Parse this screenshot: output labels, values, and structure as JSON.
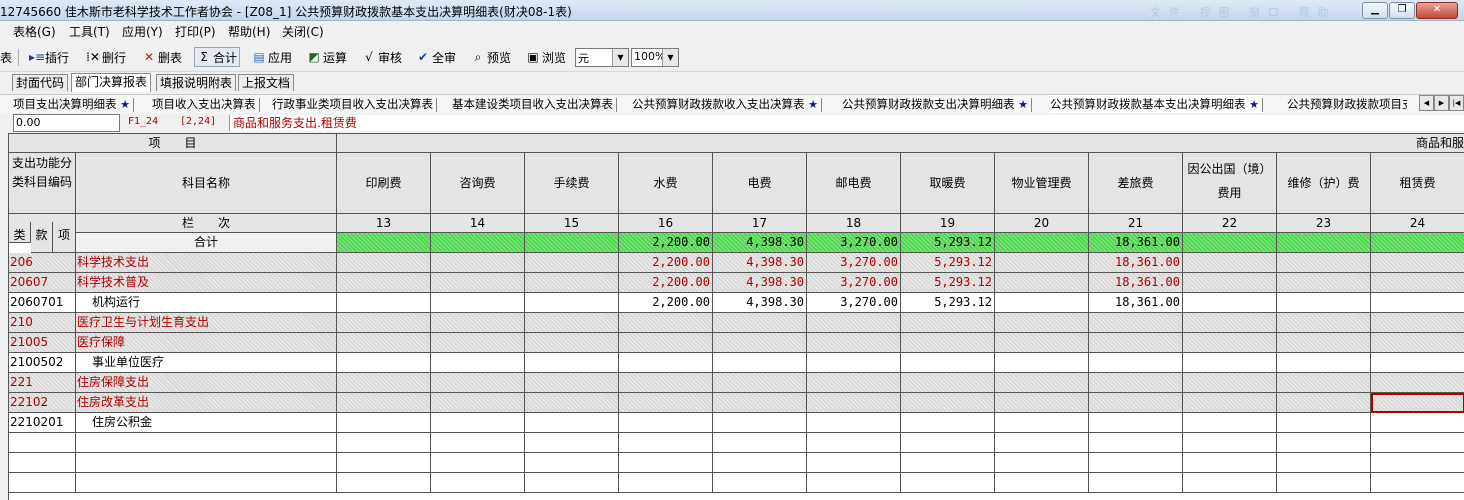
{
  "window": {
    "title": "12745660 佳木斯市老科学技术工作者协会 - [Z08_1] 公共预算财政拨款基本支出决算明细表(财决08-1表)",
    "ghost_text": "文件 视图 窗口 帮助"
  },
  "menu": [
    "表格(G)",
    "工具(T)",
    "应用(Y)",
    "打印(P)",
    "帮助(H)",
    "关闭(C)"
  ],
  "toolbar": {
    "partial": "表",
    "insert_row": "插行",
    "delete_row": "删行",
    "delete_table": "删表",
    "sum": "合计",
    "apply": "应用",
    "calc": "运算",
    "review": "审核",
    "review_all": "全审",
    "preview": "预览",
    "browse": "浏览",
    "unit_value": "元",
    "zoom_value": "100%"
  },
  "tabs_primary": [
    {
      "label": "封面代码",
      "active": false
    },
    {
      "label": "部门决算报表",
      "active": true
    },
    {
      "label": "填报说明附表",
      "active": false
    },
    {
      "label": "上报文档",
      "active": false
    }
  ],
  "tabs_secondary": [
    {
      "label": "项目支出决算明细表",
      "star": true,
      "active": false
    },
    {
      "label": "项目收入支出决算表",
      "star": false,
      "active": false
    },
    {
      "label": "行政事业类项目收入支出决算表",
      "star": false,
      "active": false
    },
    {
      "label": "基本建设类项目收入支出决算表",
      "star": false,
      "active": false
    },
    {
      "label": "公共预算财政拨款收入支出决算表",
      "star": true,
      "active": false
    },
    {
      "label": "公共预算财政拨款支出决算明细表",
      "star": true,
      "active": false
    },
    {
      "label": "公共预算财政拨款基本支出决算明细表",
      "star": true,
      "active": true
    },
    {
      "label": "公共预算财政拨款项目支出",
      "star": false,
      "active": false
    }
  ],
  "formula_bar": {
    "value": "0.00",
    "ref": "F1_24",
    "coord": "[2,24]",
    "desc": "商品和服务支出.租赁费"
  },
  "table": {
    "header_item": "项　　目",
    "header_group": "商品和服",
    "code_header": "支出功能分类科目编码",
    "name_header": "科目名称",
    "lanci": "栏　　次",
    "lei": "类",
    "kuan": "款",
    "xiang": "项",
    "columns": [
      {
        "name": "印刷费",
        "num": "13"
      },
      {
        "name": "咨询费",
        "num": "14"
      },
      {
        "name": "手续费",
        "num": "15"
      },
      {
        "name": "水费",
        "num": "16"
      },
      {
        "name": "电费",
        "num": "17"
      },
      {
        "name": "邮电费",
        "num": "18"
      },
      {
        "name": "取暖费",
        "num": "19"
      },
      {
        "name": "物业管理费",
        "num": "20"
      },
      {
        "name": "差旅费",
        "num": "21"
      },
      {
        "name": "因公出国（境）费用",
        "num": "22"
      },
      {
        "name": "维修（护）费",
        "num": "23"
      },
      {
        "name": "租赁费",
        "num": "24"
      }
    ],
    "total_label": "合计",
    "total_values": [
      "",
      "",
      "",
      "2,200.00",
      "4,398.30",
      "3,270.00",
      "5,293.12",
      "",
      "18,361.00",
      "",
      "",
      ""
    ],
    "rows": [
      {
        "code": "206",
        "name": "科学技术支出",
        "level": 1,
        "values": [
          "",
          "",
          "",
          "2,200.00",
          "4,398.30",
          "3,270.00",
          "5,293.12",
          "",
          "18,361.00",
          "",
          "",
          ""
        ]
      },
      {
        "code": "20607",
        "name": "科学技术普及",
        "level": 2,
        "values": [
          "",
          "",
          "",
          "2,200.00",
          "4,398.30",
          "3,270.00",
          "5,293.12",
          "",
          "18,361.00",
          "",
          "",
          ""
        ]
      },
      {
        "code": "2060701",
        "name": "机构运行",
        "level": 3,
        "values": [
          "",
          "",
          "",
          "2,200.00",
          "4,398.30",
          "3,270.00",
          "5,293.12",
          "",
          "18,361.00",
          "",
          "",
          ""
        ]
      },
      {
        "code": "210",
        "name": "医疗卫生与计划生育支出",
        "level": 1,
        "values": [
          "",
          "",
          "",
          "",
          "",
          "",
          "",
          "",
          "",
          "",
          "",
          ""
        ]
      },
      {
        "code": "21005",
        "name": "医疗保障",
        "level": 2,
        "values": [
          "",
          "",
          "",
          "",
          "",
          "",
          "",
          "",
          "",
          "",
          "",
          ""
        ]
      },
      {
        "code": "2100502",
        "name": "事业单位医疗",
        "level": 3,
        "values": [
          "",
          "",
          "",
          "",
          "",
          "",
          "",
          "",
          "",
          "",
          "",
          ""
        ]
      },
      {
        "code": "221",
        "name": "住房保障支出",
        "level": 1,
        "values": [
          "",
          "",
          "",
          "",
          "",
          "",
          "",
          "",
          "",
          "",
          "",
          ""
        ]
      },
      {
        "code": "22102",
        "name": "住房改革支出",
        "level": 2,
        "values": [
          "",
          "",
          "",
          "",
          "",
          "",
          "",
          "",
          "",
          "",
          "",
          ""
        ]
      },
      {
        "code": "2210201",
        "name": "住房公积金",
        "level": 3,
        "values": [
          "",
          "",
          "",
          "",
          "",
          "",
          "",
          "",
          "",
          "",
          "",
          ""
        ]
      }
    ],
    "empty_rows": 3
  }
}
